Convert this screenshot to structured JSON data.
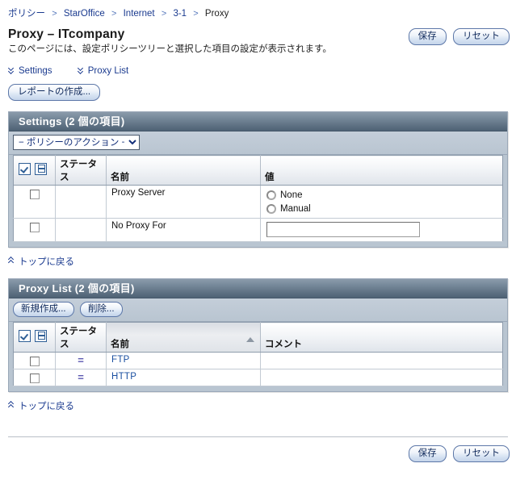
{
  "breadcrumb": {
    "separator": ">",
    "items": [
      {
        "label": "ポリシー",
        "current": false
      },
      {
        "label": "StarOffice",
        "current": false
      },
      {
        "label": "Internet",
        "current": false
      },
      {
        "label": "3-1",
        "current": false
      },
      {
        "label": "Proxy",
        "current": true
      }
    ]
  },
  "header": {
    "title": "Proxy – ITcompany",
    "description": "このページには、設定ポリシーツリーと選択した項目の設定が表示されます。",
    "save_label": "保存",
    "reset_label": "リセット"
  },
  "anchor_nav": {
    "items": [
      {
        "label": "Settings",
        "icon": "double-chevron-down-icon"
      },
      {
        "label": "Proxy List",
        "icon": "double-chevron-down-icon"
      }
    ]
  },
  "report_button": {
    "label": "レポートの作成..."
  },
  "settings_panel": {
    "title": "Settings (2 個の項目)",
    "policy_action_select": {
      "selected": "− ポリシーのアクション −",
      "options": [
        "− ポリシーのアクション −"
      ]
    },
    "columns": [
      {
        "key": "check",
        "label": ""
      },
      {
        "key": "status",
        "label": "ステータス"
      },
      {
        "key": "name",
        "label": "名前"
      },
      {
        "key": "value",
        "label": "値"
      }
    ],
    "header_icons": [
      {
        "name": "select-all-icon"
      },
      {
        "name": "select-rows-icon"
      }
    ],
    "rows": [
      {
        "checked": false,
        "status": "",
        "name": "Proxy Server",
        "value_type": "radio",
        "radios": [
          {
            "label": "None",
            "selected": false
          },
          {
            "label": "Manual",
            "selected": false
          }
        ]
      },
      {
        "checked": false,
        "status": "",
        "name": "No Proxy For",
        "value_type": "text",
        "text_value": "",
        "text_placeholder": ""
      }
    ]
  },
  "back_to_top_1": {
    "label": "トップに戻る",
    "icon": "double-chevron-up-icon"
  },
  "proxylist_panel": {
    "title": "Proxy List (2 個の項目)",
    "toolbar": {
      "new_label": "新規作成...",
      "delete_label": "削除..."
    },
    "columns": [
      {
        "key": "check",
        "label": ""
      },
      {
        "key": "status",
        "label": "ステータス"
      },
      {
        "key": "name",
        "label": "名前",
        "sorted": "asc"
      },
      {
        "key": "comment",
        "label": "コメント"
      }
    ],
    "header_icons": [
      {
        "name": "select-all-icon"
      },
      {
        "name": "select-rows-icon"
      }
    ],
    "rows": [
      {
        "checked": false,
        "status_icon": "=",
        "name": "FTP",
        "comment": ""
      },
      {
        "checked": false,
        "status_icon": "=",
        "name": "HTTP",
        "comment": ""
      }
    ]
  },
  "back_to_top_2": {
    "label": "トップに戻る",
    "icon": "double-chevron-up-icon"
  },
  "footer": {
    "save_label": "保存",
    "reset_label": "リセット"
  },
  "colors": {
    "link": "#1a3a8f",
    "panel_header_dark": "#4e6275",
    "panel_header_light": "#8b9bab",
    "toolbar_bg": "#b9c5d1",
    "status_icon": "#5b57b0",
    "row_link": "#1a4fa0"
  }
}
